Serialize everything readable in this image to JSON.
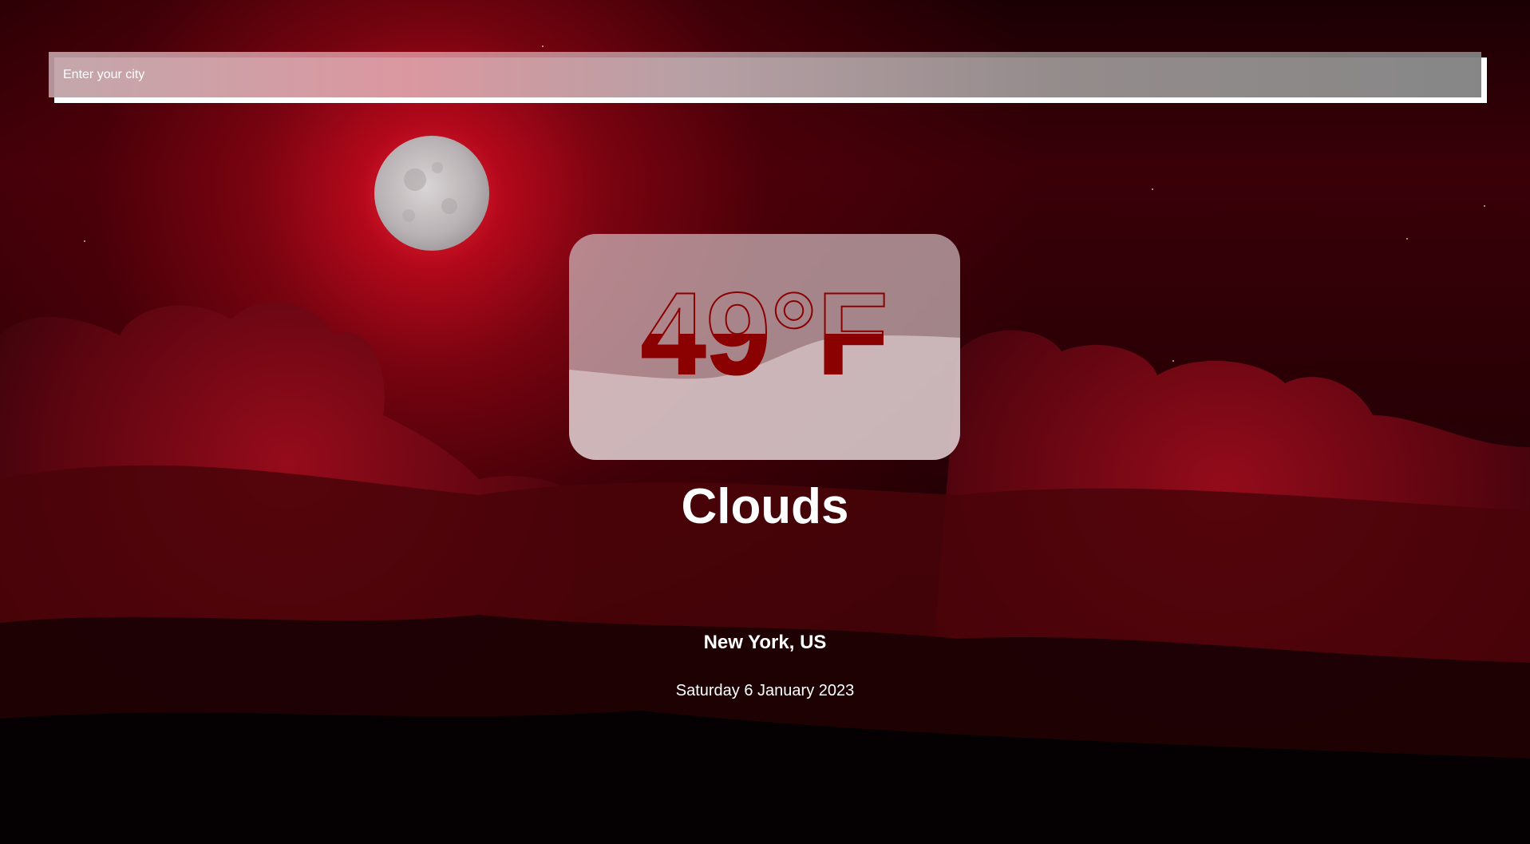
{
  "search": {
    "placeholder": "Enter your city",
    "value": ""
  },
  "weather": {
    "temperature": "49°F",
    "condition": "Clouds",
    "location": "New York, US",
    "date": "Saturday 6 January 2023"
  },
  "background": {
    "scene": "red moonlit night sky with clouds",
    "moon_icon": "moon-icon"
  },
  "colors": {
    "accent_text": "#8b0000",
    "text": "#ffffff",
    "card": "#cdb9bc",
    "sky_glow": "#e0102a"
  }
}
